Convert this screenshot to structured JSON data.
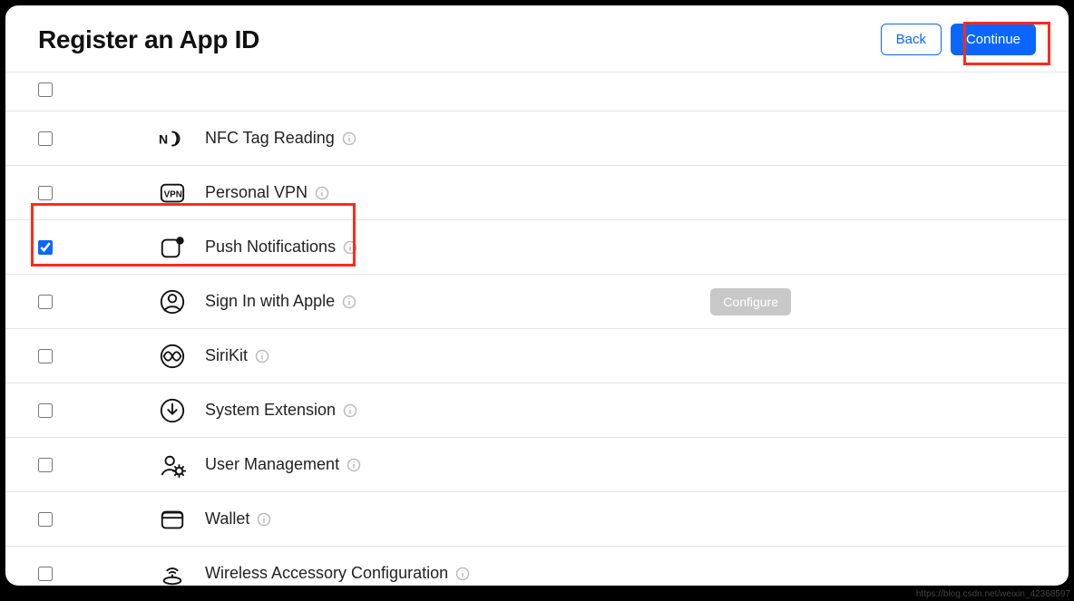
{
  "header": {
    "title": "Register an App ID",
    "back_label": "Back",
    "continue_label": "Continue"
  },
  "capabilities": [
    {
      "id": "row0",
      "label": "",
      "checked": false,
      "icon": "blank",
      "has_info": false,
      "padding": "small",
      "highlight": false
    },
    {
      "id": "nfc",
      "label": "NFC Tag Reading",
      "checked": false,
      "icon": "nfc",
      "has_info": true,
      "highlight": false
    },
    {
      "id": "vpn",
      "label": "Personal VPN",
      "checked": false,
      "icon": "vpn",
      "has_info": true,
      "highlight": false
    },
    {
      "id": "push",
      "label": "Push Notifications",
      "checked": true,
      "icon": "push",
      "has_info": true,
      "highlight": true
    },
    {
      "id": "siwa",
      "label": "Sign In with Apple",
      "checked": false,
      "icon": "person",
      "has_info": true,
      "has_configure": true,
      "configure_label": "Configure",
      "highlight": false
    },
    {
      "id": "siri",
      "label": "SiriKit",
      "checked": false,
      "icon": "siri",
      "has_info": true,
      "highlight": false
    },
    {
      "id": "sysext",
      "label": "System Extension",
      "checked": false,
      "icon": "download",
      "has_info": true,
      "highlight": false
    },
    {
      "id": "usermgmt",
      "label": "User Management",
      "checked": false,
      "icon": "usergear",
      "has_info": true,
      "highlight": false
    },
    {
      "id": "wallet",
      "label": "Wallet",
      "checked": false,
      "icon": "wallet",
      "has_info": true,
      "highlight": false
    },
    {
      "id": "wac",
      "label": "Wireless Accessory Configuration",
      "checked": false,
      "icon": "wireless",
      "has_info": true,
      "highlight": false
    }
  ],
  "watermark": "https://blog.csdn.net/weixin_42368597"
}
